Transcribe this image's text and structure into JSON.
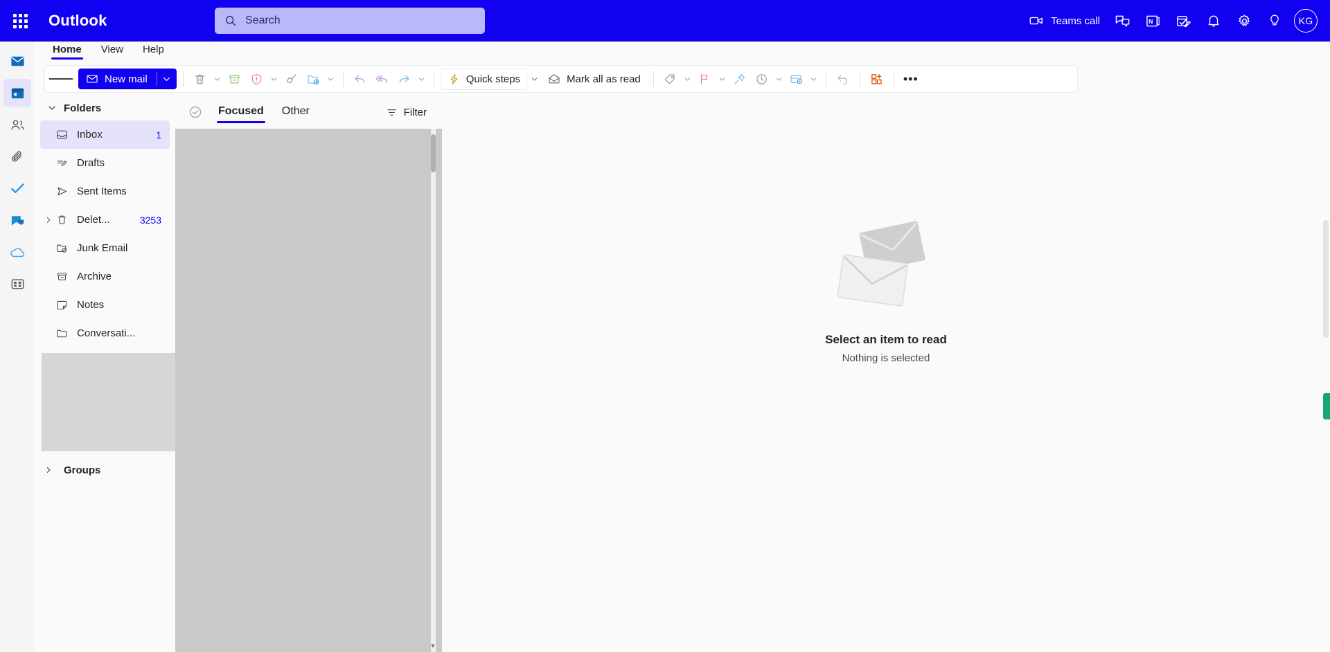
{
  "header": {
    "app_launcher": "app-launcher",
    "brand": "Outlook",
    "search_placeholder": "Search",
    "teams_call_label": "Teams call",
    "avatar_initials": "KG",
    "icons": [
      "chat-icon",
      "onenote-icon",
      "todo-icon",
      "bell-icon",
      "gear-icon",
      "lightbulb-icon"
    ],
    "background_color": "#1200f0",
    "search_background": "#b9b8fb"
  },
  "rail": {
    "items": [
      {
        "name": "mail",
        "active": false
      },
      {
        "name": "calendar",
        "active": true
      },
      {
        "name": "people",
        "active": false
      },
      {
        "name": "files",
        "active": false
      },
      {
        "name": "todo",
        "active": false
      },
      {
        "name": "yammer",
        "active": false
      },
      {
        "name": "onedrive",
        "active": false
      },
      {
        "name": "apps",
        "active": false
      }
    ]
  },
  "ribbon": {
    "tabs": [
      {
        "label": "Home",
        "active": true
      },
      {
        "label": "View",
        "active": false
      },
      {
        "label": "Help",
        "active": false
      }
    ]
  },
  "toolbar": {
    "new_mail_label": "New mail",
    "quick_steps_label": "Quick steps",
    "mark_all_read_label": "Mark all as read",
    "overflow_label": "•••",
    "buttons": [
      "delete-icon",
      "archive-icon",
      "report-icon",
      "sweep-icon",
      "move-to-icon",
      "reply-icon",
      "reply-all-icon",
      "forward-icon",
      "tag-icon",
      "flag-icon",
      "pin-icon",
      "snooze-icon",
      "rules-icon",
      "undo-icon",
      "add-apps-icon"
    ]
  },
  "folders": {
    "group_label": "Folders",
    "groups_label": "Groups",
    "items": [
      {
        "label": "Inbox",
        "icon": "inbox-icon",
        "count": "1",
        "selected": true,
        "expandable": false
      },
      {
        "label": "Drafts",
        "icon": "drafts-icon",
        "count": "",
        "selected": false,
        "expandable": false
      },
      {
        "label": "Sent Items",
        "icon": "sent-icon",
        "count": "",
        "selected": false,
        "expandable": false
      },
      {
        "label": "Delet...",
        "icon": "trash-icon",
        "count": "3253",
        "selected": false,
        "expandable": true
      },
      {
        "label": "Junk Email",
        "icon": "junk-icon",
        "count": "",
        "selected": false,
        "expandable": false
      },
      {
        "label": "Archive",
        "icon": "archive-icon",
        "count": "",
        "selected": false,
        "expandable": false
      },
      {
        "label": "Notes",
        "icon": "notes-icon",
        "count": "",
        "selected": false,
        "expandable": false
      },
      {
        "label": "Conversati...",
        "icon": "folder-icon",
        "count": "",
        "selected": false,
        "expandable": false
      }
    ]
  },
  "message_list": {
    "pivots": [
      {
        "label": "Focused",
        "active": true
      },
      {
        "label": "Other",
        "active": false
      }
    ],
    "filter_label": "Filter",
    "items": []
  },
  "reading_pane": {
    "empty_title": "Select an item to read",
    "empty_subtitle": "Nothing is selected"
  }
}
